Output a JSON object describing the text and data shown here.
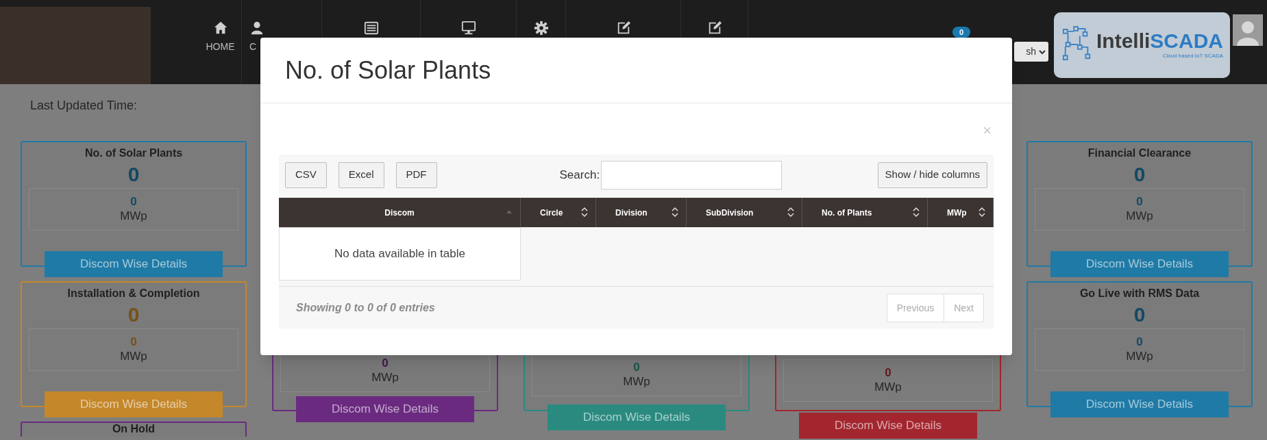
{
  "navbar": {
    "items": [
      {
        "kind": "house",
        "label": "HOME"
      },
      {
        "kind": "user",
        "label": "C"
      },
      {
        "kind": "list"
      },
      {
        "kind": "monitor"
      },
      {
        "kind": "gear"
      },
      {
        "kind": "edit"
      },
      {
        "kind": "edit"
      }
    ],
    "notification_count": "0",
    "language": "sh",
    "logo": {
      "name": [
        "Intelli",
        "SCADA"
      ],
      "tagline": "Cloud based IoT SCADA"
    }
  },
  "last_updated_label": "Last Updated Time:",
  "columns": [
    {
      "cards": [
        {
          "title": "No. of Solar Plants",
          "count": "0",
          "mwp_value": "0",
          "unit": "MWp",
          "button": "Discom Wise Details",
          "color": "#1f7aa6"
        },
        {
          "title": "Installation & Completion",
          "count": "0",
          "mwp_value": "0",
          "unit": "MWp",
          "button": "Discom Wise Details",
          "color": "#c4872a"
        },
        {
          "title": "On Hold",
          "color": "#6a2a80"
        }
      ]
    },
    {
      "cards": [
        {
          "mwp_value": "0",
          "unit": "MWp",
          "button": "Discom Wise Details",
          "color": "#6a2a80"
        }
      ]
    },
    {
      "cards": [
        {
          "mwp_value": "0",
          "unit": "MWp",
          "button": "Discom Wise Details",
          "color": "#2a8a80"
        }
      ]
    },
    {
      "cards": [
        {
          "mwp_value": "0",
          "unit": "MWp",
          "button": "Discom Wise Details",
          "color": "#a3262f"
        }
      ]
    },
    {
      "cards": [
        {
          "title": "Financial Clearance",
          "count": "0",
          "mwp_value": "0",
          "unit": "MWp",
          "button": "Discom Wise Details",
          "color": "#1f7aa6"
        },
        {
          "title": "Go Live with RMS Data",
          "count": "0",
          "mwp_value": "0",
          "unit": "MWp",
          "button": "Discom Wise Details",
          "color": "#1f7aa6"
        }
      ]
    }
  ],
  "modal": {
    "title": "No. of Solar Plants",
    "close": "×",
    "export_buttons": [
      "CSV",
      "Excel",
      "PDF"
    ],
    "search_label": "Search:",
    "column_toggle": "Show / hide columns",
    "table": {
      "columns": [
        {
          "label": "Discom",
          "sorted": true
        },
        {
          "label": "Circle",
          "sorted": false
        },
        {
          "label": "Division",
          "sorted": false
        },
        {
          "label": "SubDivision",
          "sorted": false
        },
        {
          "label": "No. of Plants",
          "sorted": false
        },
        {
          "label": "MWp",
          "sorted": false
        }
      ],
      "empty_message": "No data available in table"
    },
    "info": "Showing 0 to 0 of 0 entries",
    "pagination": [
      {
        "label": "Previous",
        "disabled": true
      },
      {
        "label": "Next",
        "disabled": true
      }
    ]
  }
}
